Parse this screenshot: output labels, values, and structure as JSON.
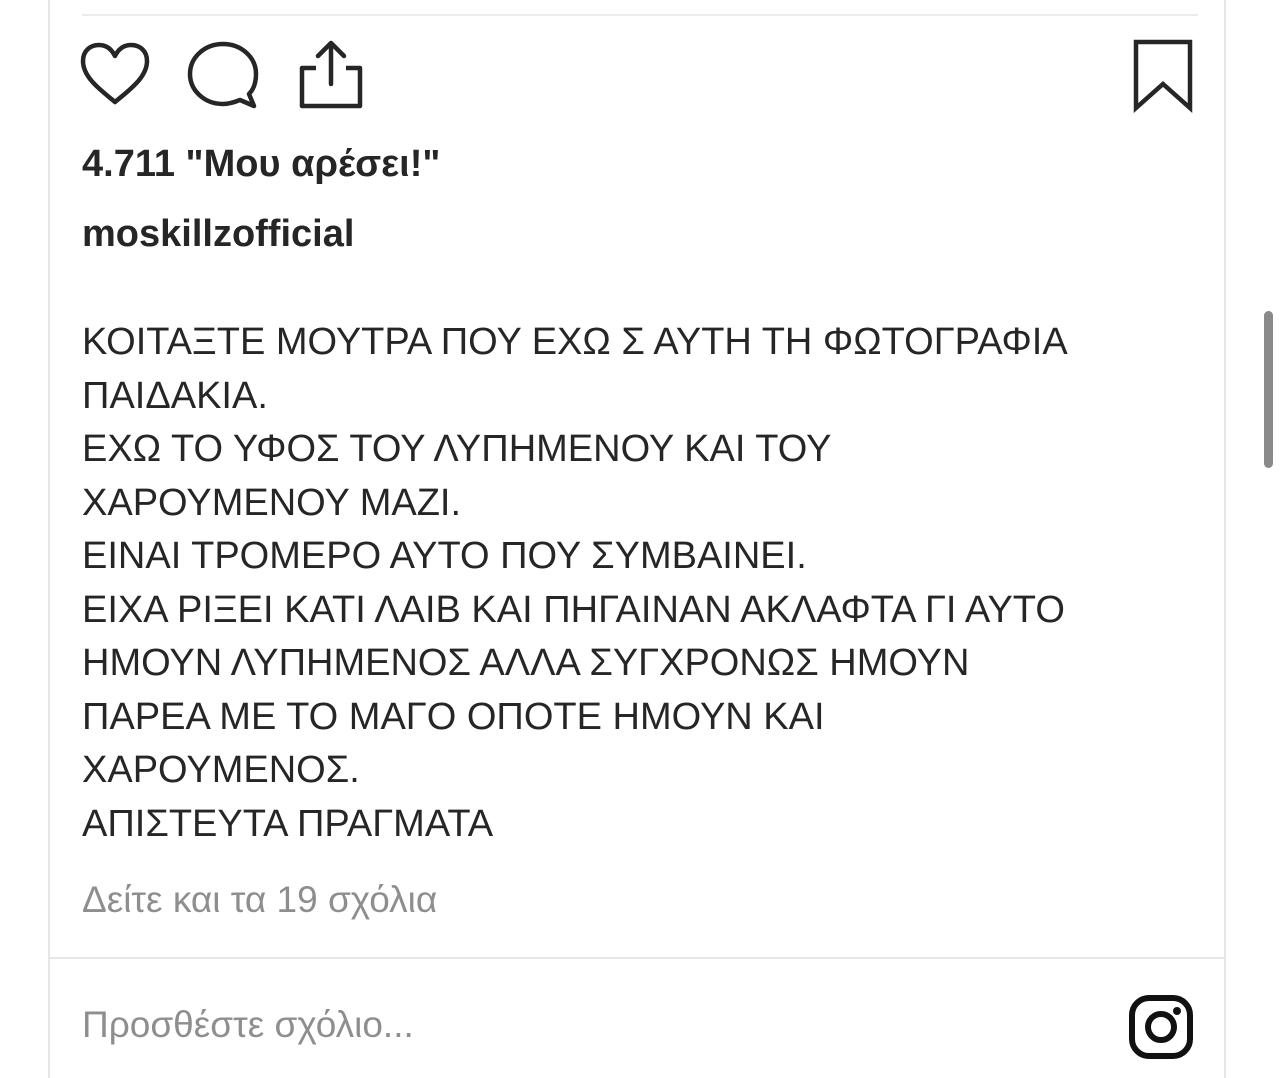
{
  "post": {
    "likes_text": "4.711 \"Μου αρέσει!\"",
    "username": "moskillzofficial",
    "caption_lines": [
      "ΚΟΙΤΑΞΤΕ ΜΟΥΤΡΑ ΠΟΥ ΕΧΩ Σ ΑΥΤΗ ΤΗ ΦΩΤΟΓΡΑΦΙΑ",
      "ΠΑΙΔΑΚΙΑ.",
      "ΕΧΩ ΤΟ ΥΦΟΣ ΤΟΥ ΛΥΠΗΜΕΝΟΥ ΚΑΙ ΤΟΥ",
      "ΧΑΡΟΥΜΕΝΟΥ ΜΑΖΙ.",
      "ΕΙΝΑΙ ΤΡΟΜΕΡΟ ΑΥΤΟ ΠΟΥ ΣΥΜΒΑΙΝΕΙ.",
      "ΕΙΧΑ ΡΙΞΕΙ ΚΑΤΙ ΛΑΙΒ ΚΑΙ ΠΗΓΑΙΝΑΝ ΑΚΛΑΦΤΑ ΓΙ ΑΥΤΟ",
      "ΗΜΟΥΝ ΛΥΠΗΜΕΝΟΣ ΑΛΛΑ ΣΥΓΧΡΟΝΩΣ ΗΜΟΥΝ",
      "ΠΑΡΕΑ ΜΕ ΤΟ ΜΑΓΟ ΟΠΟΤΕ ΗΜΟΥΝ ΚΑΙ",
      "ΧΑΡΟΥΜΕΝΟΣ.",
      "ΑΠΙΣΤΕΥΤΑ ΠΡΑΓΜΑΤΑ"
    ],
    "view_comments_text": "Δείτε και τα 19 σχόλια"
  },
  "actions": {
    "like_icon": "heart-icon",
    "comment_icon": "comment-bubble-icon",
    "share_icon": "share-upload-icon",
    "save_icon": "bookmark-icon"
  },
  "comment_box": {
    "placeholder": "Προσθέστε σχόλιο...",
    "value": "",
    "brand_icon": "instagram-logo-icon"
  },
  "colors": {
    "text": "#262626",
    "muted": "#8e8e8e",
    "divider": "#e6e6e6"
  }
}
